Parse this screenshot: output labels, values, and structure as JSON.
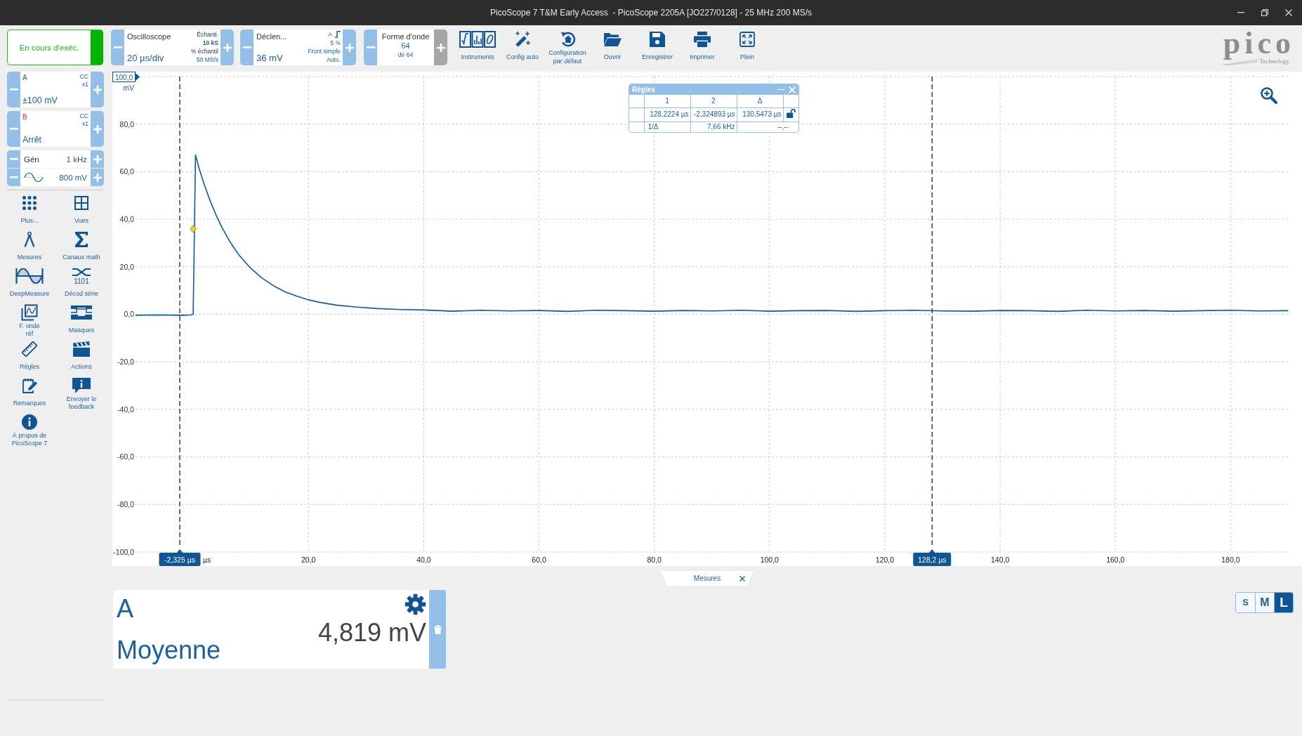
{
  "window": {
    "title": "PicoScope 7 T&M Early Access  - PicoScope 2205A [JO227/0128] - 25 MHz 200 MS/s"
  },
  "toolbar": {
    "run_button": {
      "label": "En cours d'exéc.",
      "running": true
    },
    "timebase": {
      "title": "Oscilloscope",
      "value": "20 µs/div",
      "samples_label": "Échanti.",
      "samples": "10 kS",
      "rate_label": "% échantil",
      "rate": "50 MS/s"
    },
    "trigger": {
      "title": "Déclen...",
      "value": "36 mV",
      "channel": "A",
      "pretrigger": "5 %",
      "type": "Front simple",
      "mode": "Auto."
    },
    "waveforms": {
      "title": "Forme d'onde",
      "current": "64",
      "total": "de 64",
      "next_disabled": true
    },
    "tools": [
      {
        "kind": "instruments",
        "label": "Instruments"
      },
      {
        "kind": "autosetup",
        "label": "Config auto"
      },
      {
        "kind": "default",
        "label": "Configuration\npar défaut"
      },
      {
        "kind": "open",
        "label": "Ouvrir"
      },
      {
        "kind": "save",
        "label": "Enregistrer"
      },
      {
        "kind": "print",
        "label": "Imprimer"
      },
      {
        "kind": "fullscreen",
        "label": "Plein"
      }
    ],
    "logo": {
      "name": "pico",
      "tagline": "Technology"
    }
  },
  "channels": [
    {
      "name": "A",
      "color": "#1a5f9e",
      "coupling": "CC",
      "probe": "x1",
      "range": "±100 mV"
    },
    {
      "name": "B",
      "color": "#e3262e",
      "coupling": "CC",
      "probe": "x1",
      "range": "Arrêt"
    }
  ],
  "generator": {
    "label": "Gén",
    "frequency": "1 kHz",
    "amplitude": "800 mV"
  },
  "sidebar_tools": [
    {
      "kind": "more",
      "label": "Plus..."
    },
    {
      "kind": "measurements",
      "label": "Mesures"
    },
    {
      "kind": "deepmeasure",
      "label": "DeepMeasure"
    },
    {
      "kind": "reference",
      "label": "F. onde\nréf"
    },
    {
      "kind": "rulers",
      "label": "Règles"
    },
    {
      "kind": "notes",
      "label": "Remarques"
    },
    {
      "kind": "about",
      "label": "À propos de\nPicoScope 7"
    },
    {
      "kind": "views",
      "label": "Vues"
    },
    {
      "kind": "math",
      "label": "Canaux math"
    },
    {
      "kind": "serial",
      "label": "Décod série",
      "icon_text": "1101"
    },
    {
      "kind": "masks",
      "label": "Masques"
    },
    {
      "kind": "actions",
      "label": "Actions"
    },
    {
      "kind": "feedback",
      "label": "Envoyer le\nfeedback"
    }
  ],
  "chart": {
    "chart_data": {
      "type": "line",
      "xlabel": "µs",
      "ylabel": "mV",
      "grid": true,
      "x": [
        -10,
        -6,
        -2,
        -0.5,
        0,
        0.4,
        1,
        2,
        3,
        4,
        5,
        6,
        7,
        8,
        10,
        12,
        14,
        16,
        18,
        20,
        22,
        25,
        28,
        32,
        36,
        40,
        45,
        50,
        55,
        60,
        65,
        70,
        75,
        80,
        85,
        90,
        95,
        100,
        105,
        110,
        115,
        120,
        125,
        130,
        135,
        140,
        145,
        150,
        155,
        160,
        165,
        170,
        175,
        180,
        185,
        190
      ],
      "series": [
        {
          "color": "#0f5a9e",
          "values": [
            -0.4,
            -0.3,
            -0.4,
            -0.3,
            0,
            67,
            61.6,
            54,
            47.4,
            41.6,
            36.5,
            32.1,
            28.2,
            24.8,
            19.3,
            15.1,
            11.9,
            9.4,
            7.6,
            6.1,
            5,
            3.8,
            3.1,
            2.4,
            2,
            1.8,
            1.3,
            1.7,
            1.4,
            1.6,
            1.2,
            1.7,
            1.5,
            1.3,
            1.6,
            1.4,
            1.7,
            1.3,
            1.5,
            1.6,
            1.2,
            1.5,
            1.7,
            1.4,
            1.3,
            1.6,
            1.5,
            1.2,
            1.7,
            1.4,
            1.6,
            1.3,
            1.5,
            1.7,
            1.4,
            1.5
          ]
        }
      ],
      "xlim": [
        -10,
        190
      ],
      "ylim": [
        -100,
        100
      ],
      "xticks": [
        {
          "value": 20,
          "label": "20,0"
        },
        {
          "value": 40,
          "label": "40,0"
        },
        {
          "value": 60,
          "label": "60,0"
        },
        {
          "value": 80,
          "label": "80,0"
        },
        {
          "value": 100,
          "label": "100,0"
        },
        {
          "value": 120,
          "label": "120,0"
        },
        {
          "value": 140,
          "label": "140,0"
        },
        {
          "value": 160,
          "label": "160,0"
        },
        {
          "value": 180,
          "label": "180,0"
        }
      ],
      "yticks": [
        {
          "value": 100,
          "label": "100,0"
        },
        {
          "value": 80,
          "label": "80,0"
        },
        {
          "value": 60,
          "label": "60,0"
        },
        {
          "value": 40,
          "label": "40,0"
        },
        {
          "value": 20,
          "label": "20,0"
        },
        {
          "value": 0,
          "label": "0,0"
        },
        {
          "value": -20,
          "label": "-20,0"
        },
        {
          "value": -40,
          "label": "-40,0"
        },
        {
          "value": -60,
          "label": "-60,0"
        },
        {
          "value": -80,
          "label": "-80,0"
        },
        {
          "value": -100,
          "label": "-100,0"
        }
      ],
      "ref_lines": [
        {
          "axis": "x",
          "value": -2.325,
          "label": "-2,325 µs"
        },
        {
          "axis": "x",
          "value": 128.2,
          "label": "128,2 µs"
        }
      ]
    },
    "rulers_panel": {
      "title": "Règles",
      "columns": [
        "1",
        "2",
        "Δ"
      ],
      "positions": [
        "128,2224 µs",
        "-2,324893 µs",
        "130,5473 µs"
      ],
      "locked": false,
      "inverse_label": "1/Δ",
      "frequency": "7,66 kHz",
      "frequency_delta": "--,--"
    }
  },
  "measurement_tabs": [
    {
      "label": "Mesures",
      "selected": true
    }
  ],
  "measurements": [
    {
      "channel": "A",
      "name": "Moyenne",
      "value": "4,819 mV"
    }
  ],
  "view_sizes": [
    {
      "label": "S",
      "selected": false
    },
    {
      "label": "M",
      "selected": false
    },
    {
      "label": "L",
      "selected": true
    }
  ]
}
